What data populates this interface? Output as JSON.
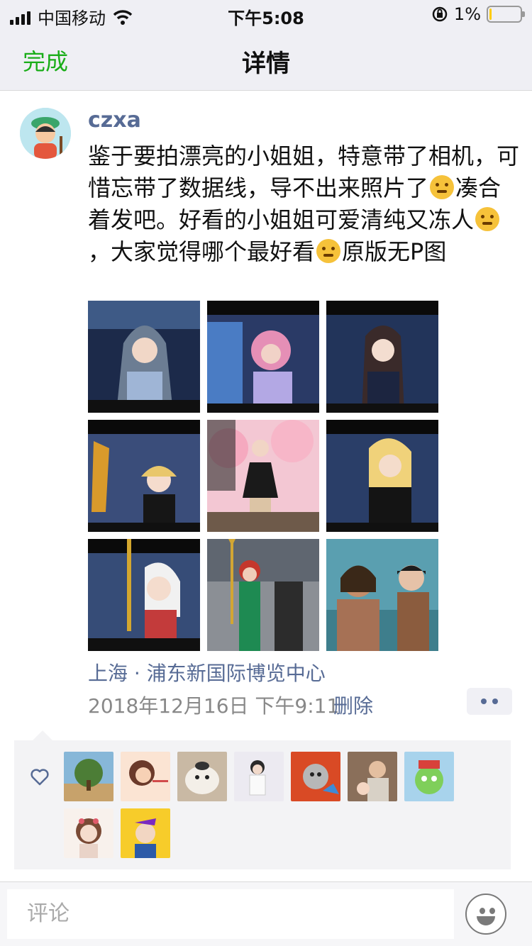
{
  "status_bar": {
    "carrier": "中国移动",
    "time": "下午5:08",
    "battery_percent": "1%",
    "battery_level": 0.06,
    "battery_color": "#ffcc00"
  },
  "nav": {
    "done_label": "完成",
    "title": "详情"
  },
  "post": {
    "username": "czxa",
    "text_segments": [
      "鉴于要拍漂亮的小姐姐，特意带了相机，可惜忘带了数据线，导不出来照片了",
      "凑合着发吧。好看的小姐姐可爱清纯又冻人",
      "，大家觉得哪个最好看",
      "原版无P图"
    ],
    "emojis": [
      "thinking-emoji",
      "grinning-emoji",
      "smirk-emoji"
    ],
    "photos": [
      "cosplay-photo-1",
      "cosplay-photo-2",
      "cosplay-photo-3",
      "cosplay-photo-4",
      "cosplay-photo-5",
      "cosplay-photo-6",
      "cosplay-photo-7",
      "cosplay-photo-8",
      "cosplay-photo-9"
    ],
    "location": "上海 · 浦东新国际博览中心",
    "timestamp": "2018年12月16日 下午9:11",
    "delete_label": "删除",
    "link_color": "#576b95"
  },
  "likes": {
    "icon": "heart-icon",
    "avatars": [
      "like-avatar-1",
      "like-avatar-2",
      "like-avatar-3",
      "like-avatar-4",
      "like-avatar-5",
      "like-avatar-6",
      "like-avatar-7",
      "like-avatar-8",
      "like-avatar-9"
    ]
  },
  "comment": {
    "placeholder": "评论",
    "emoji_icon": "smiley-icon"
  },
  "accent_color": "#1aad19"
}
